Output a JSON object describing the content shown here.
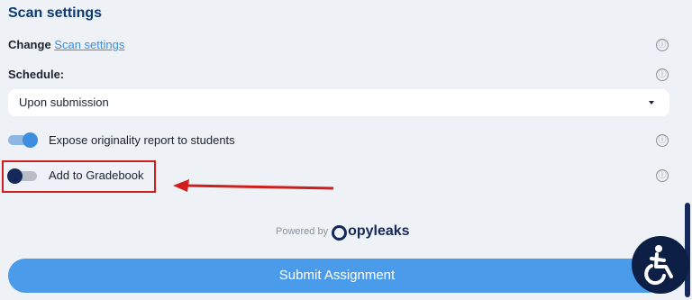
{
  "section": {
    "title": "Scan settings"
  },
  "change_row": {
    "prefix": "Change",
    "link": "Scan settings"
  },
  "schedule": {
    "label": "Schedule:",
    "selected": "Upon submission"
  },
  "toggles": [
    {
      "label": "Expose originality report to students",
      "on": true
    },
    {
      "label": "Add to Gradebook",
      "on": false
    }
  ],
  "info_icon": "ⓘ",
  "powered": {
    "by": "Powered by",
    "brand": "opyleaks"
  },
  "submit_label": "Submit Assignment",
  "icons": {
    "info": "info-icon",
    "caret": "chevron-down-icon",
    "accessibility": "accessibility-icon",
    "brand_logo": "copyleaks-logo-icon",
    "annotation_arrow": "arrow-left-icon"
  },
  "colors": {
    "title": "#0b3a74",
    "link": "#3d8ee0",
    "toggle_on": "#3d8ee0",
    "toggle_off_knob": "#14295a",
    "submit": "#4a9cea",
    "highlight": "#d01e1e",
    "accessibility_bg": "#0d1f45"
  }
}
